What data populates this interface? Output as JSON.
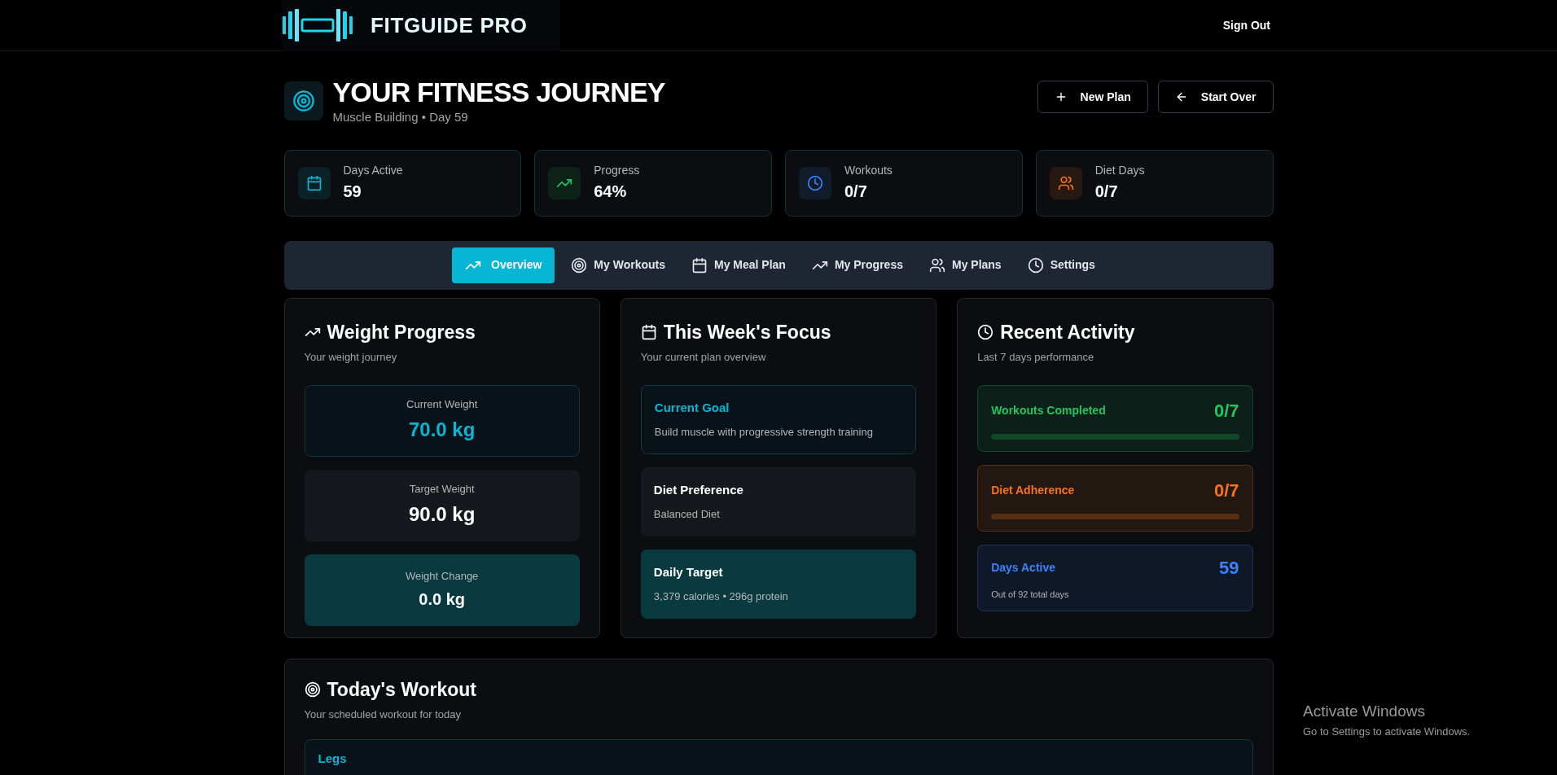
{
  "header": {
    "brand": "FITGUIDE PRO",
    "sign_out": "Sign Out"
  },
  "journey": {
    "title": "YOUR FITNESS JOURNEY",
    "subtitle": "Muscle Building • Day 59",
    "buttons": [
      {
        "kind": "plus",
        "label": "New Plan"
      },
      {
        "kind": "back",
        "label": "Start Over"
      }
    ]
  },
  "stats": [
    {
      "kind": "calendar",
      "label": "Days Active",
      "value": "59",
      "color": "#06b6d4"
    },
    {
      "kind": "trend",
      "label": "Progress",
      "value": "64%",
      "color": "#22c55e"
    },
    {
      "kind": "clock",
      "label": "Workouts",
      "value": "0/7",
      "color": "#3b82f6"
    },
    {
      "kind": "users",
      "label": "Diet Days",
      "value": "0/7",
      "color": "#f97316"
    }
  ],
  "tabs": [
    {
      "kind": "trend",
      "label": "Overview",
      "selected": true
    },
    {
      "kind": "target",
      "label": "My Workouts",
      "selected": false
    },
    {
      "kind": "calendar",
      "label": "My Meal Plan",
      "selected": false
    },
    {
      "kind": "trend",
      "label": "My Progress",
      "selected": false
    },
    {
      "kind": "users",
      "label": "My Plans",
      "selected": false
    },
    {
      "kind": "clock",
      "label": "Settings",
      "selected": false
    }
  ],
  "weight_progress": {
    "title": "Weight Progress",
    "subtitle": "Your weight journey",
    "boxes": [
      {
        "kind": "current",
        "label": "Current Weight",
        "value": "70.0 kg"
      },
      {
        "kind": "target",
        "label": "Target Weight",
        "value": "90.0 kg"
      },
      {
        "kind": "change",
        "label": "Weight Change",
        "value": "0.0 kg"
      }
    ]
  },
  "week_focus": {
    "title": "This Week's Focus",
    "subtitle": "Your current plan overview",
    "boxes": [
      {
        "kind": "goal",
        "title": "Current Goal",
        "text": "Build muscle with progressive strength training"
      },
      {
        "kind": "diet",
        "title": "Diet Preference",
        "text": "Balanced Diet"
      },
      {
        "kind": "daily",
        "title": "Daily Target",
        "text": "3,379 calories • 296g protein"
      }
    ]
  },
  "recent_activity": {
    "title": "Recent Activity",
    "subtitle": "Last 7 days performance",
    "items": [
      {
        "kind": "bar",
        "label": "Workouts Completed",
        "value": "0/7",
        "level": 0,
        "color": "#22c55e"
      },
      {
        "kind": "bar",
        "label": "Diet Adherence",
        "value": "0/7",
        "level": 0,
        "color": "#f97316"
      },
      {
        "kind": "note",
        "label": "Days Active",
        "value": "59",
        "note": "Out of 92 total days",
        "color": "#3b82f6"
      }
    ]
  },
  "todays_workout": {
    "title": "Today's Workout",
    "subtitle": "Your scheduled workout for today",
    "day": "Legs"
  },
  "os_notice": {
    "title": "Activate Windows",
    "text": "Go to Settings to activate Windows."
  }
}
